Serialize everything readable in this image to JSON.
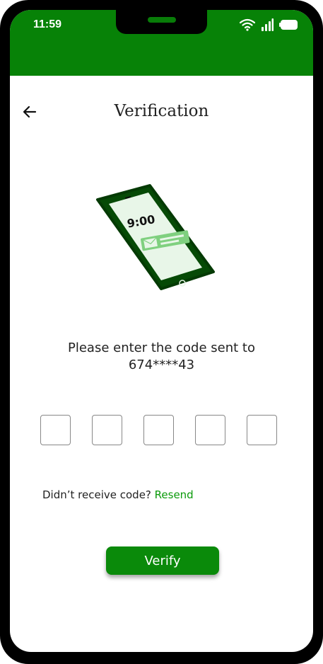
{
  "status_bar": {
    "time": "11:59"
  },
  "header": {
    "title": "Verification"
  },
  "illustration": {
    "clock_text": "9:00"
  },
  "prompt": {
    "line1": "Please enter the code sent to",
    "line2": "674****43"
  },
  "otp": {
    "fields": [
      "",
      "",
      "",
      "",
      ""
    ]
  },
  "resend": {
    "question": "Didn’t receive code? ",
    "link": "Resend"
  },
  "verify": {
    "label": "Verify"
  },
  "colors": {
    "accent": "#078207",
    "link": "#0a9a0a",
    "button": "#0a8a0a"
  }
}
